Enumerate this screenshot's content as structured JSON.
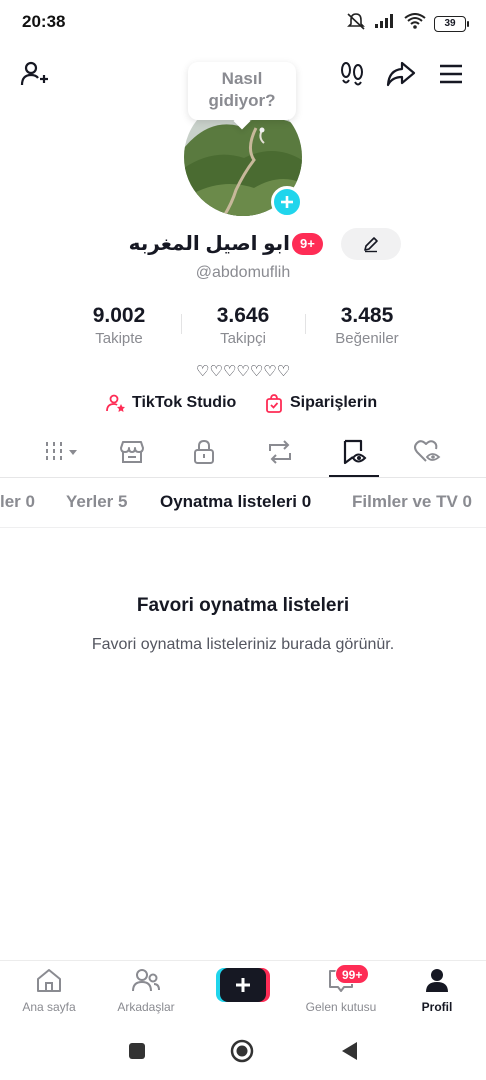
{
  "status_bar": {
    "time": "20:38",
    "battery": "39",
    "icons": [
      "mute-icon",
      "signal-icon",
      "wifi-icon",
      "battery-icon"
    ]
  },
  "top_bar": {
    "icons": [
      "add-user-icon",
      "footprints-icon",
      "share-icon",
      "menu-icon"
    ]
  },
  "profile": {
    "bubble_text": "Nasıl gidiyor?",
    "display_name": "ابو اصيل  المغربه",
    "name_badge": "9+",
    "username": "@abdomuflih",
    "bio": "♡♡♡♡♡♡♡",
    "stats": [
      {
        "value": "9.002",
        "label": "Takipte"
      },
      {
        "value": "3.646",
        "label": "Takipçi"
      },
      {
        "value": "3.485",
        "label": "Beğeniler"
      }
    ],
    "links": [
      {
        "label": "TikTok Studio",
        "icon": "studio-icon"
      },
      {
        "label": "Siparişlerin",
        "icon": "orders-icon"
      }
    ]
  },
  "content_tabs": {
    "icons": [
      "grid-filter-icon",
      "shop-icon",
      "lock-icon",
      "repost-icon",
      "favorites-icon",
      "liked-icon"
    ],
    "active_index": 4
  },
  "sub_tabs": {
    "items": [
      {
        "label": "ler 0"
      },
      {
        "label": "Yerler 5"
      },
      {
        "label": "Oynatma listeleri 0"
      },
      {
        "label": "Filmler ve TV 0"
      }
    ],
    "active_index": 2
  },
  "empty_state": {
    "title": "Favori oynatma listeleri",
    "description": "Favori oynatma listeleriniz burada görünür."
  },
  "bottom_nav": {
    "items": [
      {
        "label": "Ana sayfa",
        "icon": "home-icon"
      },
      {
        "label": "Arkadaşlar",
        "icon": "friends-icon"
      },
      {
        "label": "",
        "icon": "create-icon"
      },
      {
        "label": "Gelen kutusu",
        "icon": "inbox-icon",
        "badge": "99+"
      },
      {
        "label": "Profil",
        "icon": "profile-icon"
      }
    ],
    "active_index": 4
  },
  "colors": {
    "accent": "#fe2c55",
    "cyan": "#20d5ec",
    "text": "#161823",
    "muted": "#8a8b91"
  }
}
